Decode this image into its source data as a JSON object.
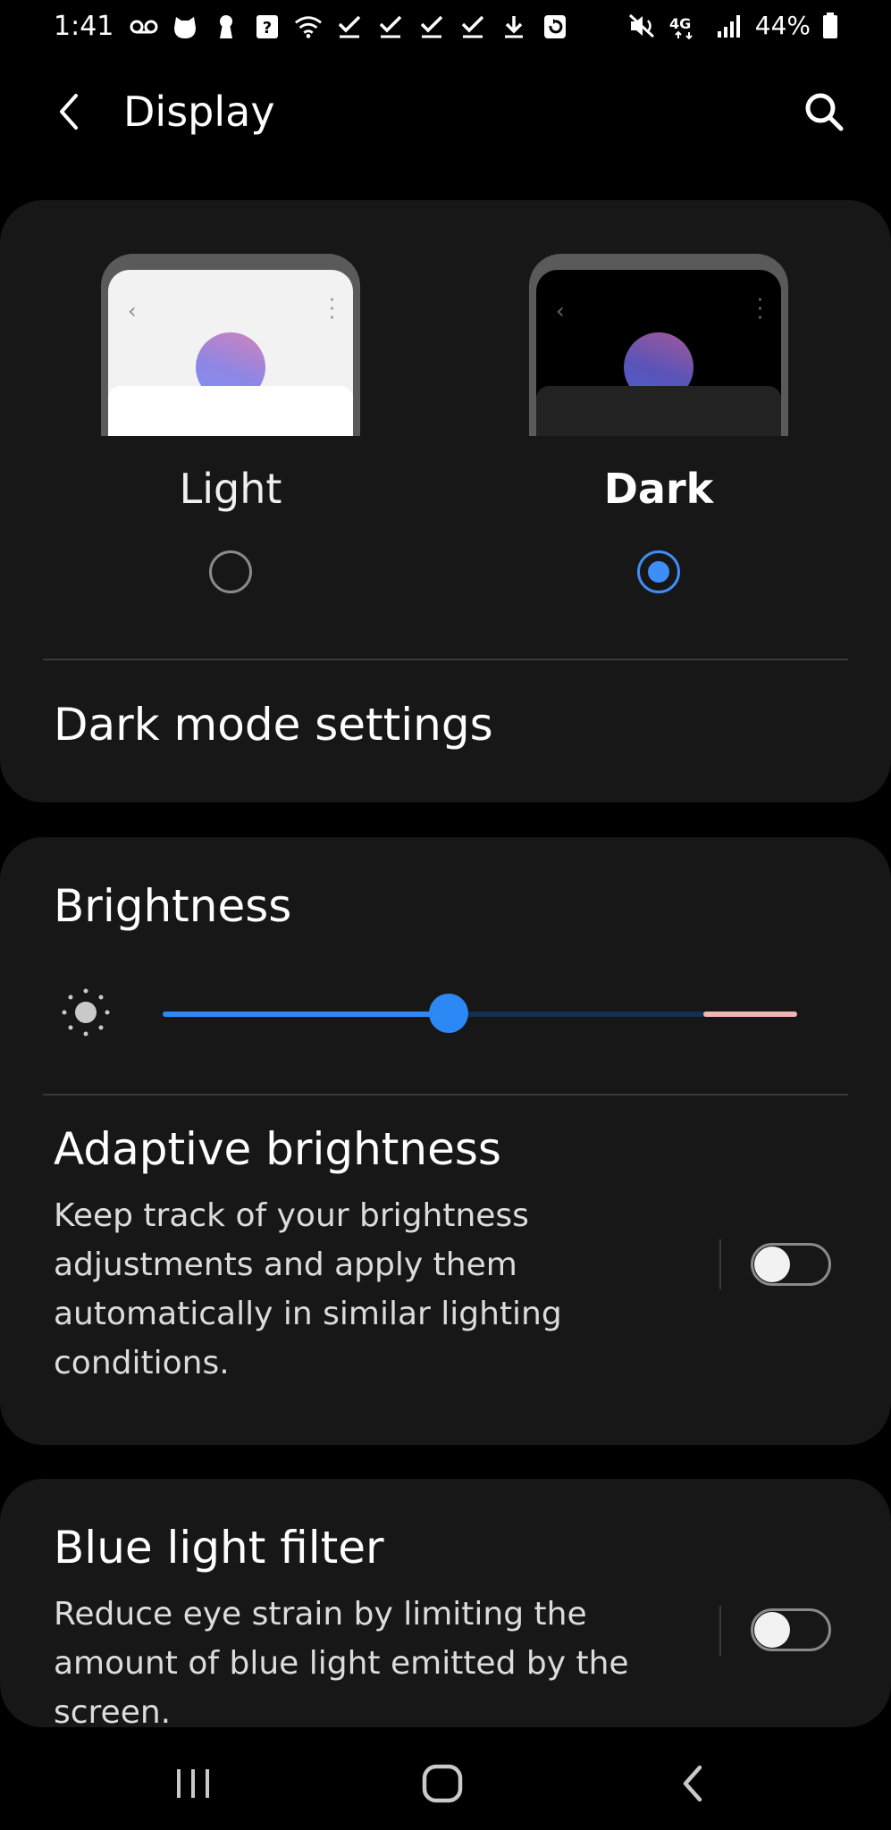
{
  "status_bar": {
    "time": "1:41",
    "network": "4G",
    "battery": "44%",
    "left_icons": [
      "voicemail-icon",
      "alien-icon",
      "keyhole-icon",
      "help-box-icon",
      "wifi-question-icon",
      "check-icon",
      "check-icon",
      "check-icon",
      "check-icon",
      "download-icon",
      "sync-icon"
    ],
    "right_icons": [
      "mute-vibrate-icon",
      "network-4g-icon",
      "signal-icon",
      "battery-icon"
    ]
  },
  "header": {
    "title": "Display",
    "back_icon": "chevron-left-icon",
    "search_icon": "search-icon"
  },
  "theme": {
    "options": [
      {
        "label": "Light",
        "selected": false
      },
      {
        "label": "Dark",
        "selected": true
      }
    ],
    "settings_label": "Dark mode settings"
  },
  "brightness": {
    "title": "Brightness",
    "level": 0.45,
    "adaptive": {
      "title": "Adaptive brightness",
      "description": "Keep track of your brightness adjustments and apply them automatically in similar lighting conditions.",
      "enabled": false
    }
  },
  "blue_light": {
    "title": "Blue light filter",
    "description": "Reduce eye strain by limiting the amount of blue light emitted by the screen.",
    "enabled": false
  },
  "nav": {
    "buttons": [
      "recent-apps-icon",
      "home-icon",
      "back-icon"
    ]
  },
  "colors": {
    "accent": "#3e8ef7",
    "card_bg": "#171717",
    "background": "#000000"
  }
}
